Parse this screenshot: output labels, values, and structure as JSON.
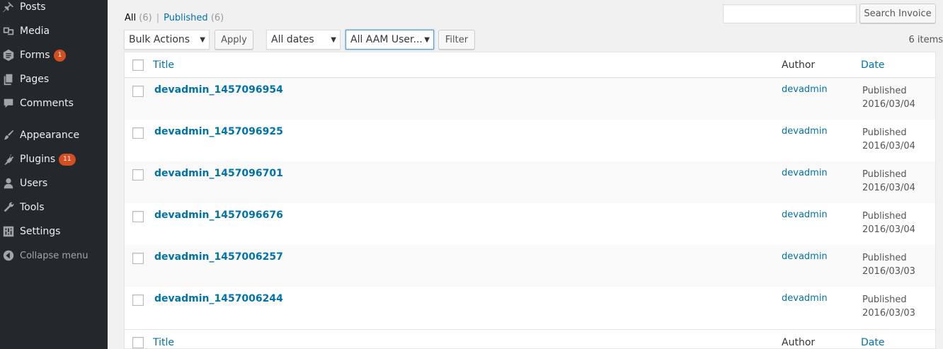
{
  "sidebar": {
    "items": [
      {
        "label": "Posts",
        "icon": "pin-icon"
      },
      {
        "label": "Media",
        "icon": "media-icon"
      },
      {
        "label": "Forms",
        "icon": "forms-icon",
        "badge": "1"
      },
      {
        "label": "Pages",
        "icon": "pages-icon"
      },
      {
        "label": "Comments",
        "icon": "comment-icon"
      },
      {
        "label": "Appearance",
        "icon": "brush-icon"
      },
      {
        "label": "Plugins",
        "icon": "plugin-icon",
        "badge": "11"
      },
      {
        "label": "Users",
        "icon": "user-icon"
      },
      {
        "label": "Tools",
        "icon": "wrench-icon"
      },
      {
        "label": "Settings",
        "icon": "settings-icon"
      }
    ],
    "collapse_label": "Collapse menu"
  },
  "filters": {
    "all_label": "All",
    "all_count": "(6)",
    "separator": "|",
    "published_label": "Published",
    "published_count": "(6)"
  },
  "search": {
    "value": "",
    "button_label": "Search Invoice"
  },
  "toolbar": {
    "bulk_actions": "Bulk Actions",
    "apply_label": "Apply",
    "dates": "All dates",
    "aam_users": "All AAM User...",
    "filter_label": "Filter",
    "items_count": "6 items"
  },
  "table": {
    "columns": {
      "title": "Title",
      "author": "Author",
      "date": "Date"
    },
    "rows": [
      {
        "title": "devadmin_1457096954",
        "author": "devadmin",
        "status": "Published",
        "date": "2016/03/04"
      },
      {
        "title": "devadmin_1457096925",
        "author": "devadmin",
        "status": "Published",
        "date": "2016/03/04"
      },
      {
        "title": "devadmin_1457096701",
        "author": "devadmin",
        "status": "Published",
        "date": "2016/03/04"
      },
      {
        "title": "devadmin_1457096676",
        "author": "devadmin",
        "status": "Published",
        "date": "2016/03/04"
      },
      {
        "title": "devadmin_1457006257",
        "author": "devadmin",
        "status": "Published",
        "date": "2016/03/03"
      },
      {
        "title": "devadmin_1457006244",
        "author": "devadmin",
        "status": "Published",
        "date": "2016/03/03"
      }
    ]
  },
  "colors": {
    "sidebar_bg": "#23282d",
    "link": "#0073aa",
    "badge": "#d54e21"
  }
}
